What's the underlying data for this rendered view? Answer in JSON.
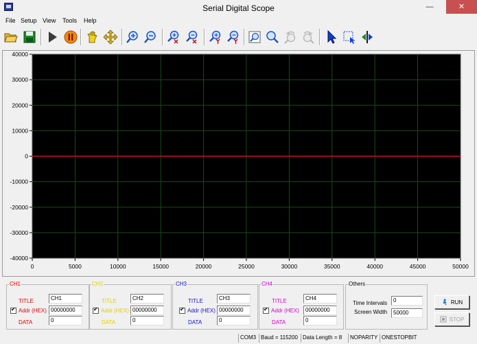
{
  "window": {
    "title": "Serial Digital Scope",
    "minimize_glyph": "—",
    "close_glyph": "✕"
  },
  "menu": [
    "File",
    "Setup",
    "View",
    "Tools",
    "Help"
  ],
  "toolbar": [
    {
      "name": "open-folder-icon",
      "enabled": true
    },
    {
      "name": "save-disk-icon",
      "enabled": true
    },
    {
      "name": "play-icon",
      "enabled": true
    },
    {
      "name": "pause-icon",
      "enabled": true
    },
    {
      "name": "hand-pan-icon",
      "enabled": true
    },
    {
      "name": "move-arrows-icon",
      "enabled": true
    },
    {
      "name": "zoom-in-icon",
      "enabled": true
    },
    {
      "name": "zoom-out-icon",
      "enabled": true
    },
    {
      "name": "zoom-in-x-icon",
      "enabled": true
    },
    {
      "name": "zoom-out-x-icon",
      "enabled": true
    },
    {
      "name": "zoom-in-y-icon",
      "enabled": true
    },
    {
      "name": "zoom-out-y-icon",
      "enabled": true
    },
    {
      "name": "zoom-fit-icon",
      "enabled": true
    },
    {
      "name": "zoom-window-icon",
      "enabled": true
    },
    {
      "name": "undo-zoom-icon",
      "enabled": false
    },
    {
      "name": "redo-zoom-icon",
      "enabled": false
    },
    {
      "name": "select-pointer-icon",
      "enabled": true
    },
    {
      "name": "select-region-icon",
      "enabled": true
    },
    {
      "name": "cursor-marker-icon",
      "enabled": true
    }
  ],
  "chart_data": {
    "type": "line",
    "background": "#000000",
    "grid": true,
    "grid_color": "#1a4a1a",
    "xlim": [
      0,
      50000
    ],
    "ylim": [
      -40000,
      40000
    ],
    "x_ticks": [
      "0",
      "5000",
      "10000",
      "15000",
      "20000",
      "25000",
      "30000",
      "35000",
      "40000",
      "45000",
      "50000"
    ],
    "y_ticks": [
      "40000",
      "30000",
      "20000",
      "10000",
      "0",
      "-10000",
      "-20000",
      "-30000",
      "-40000"
    ],
    "series": [
      {
        "color": "#d01010",
        "x": [
          0,
          50000
        ],
        "y": [
          0,
          0
        ]
      }
    ]
  },
  "channels": [
    {
      "group": "CH1",
      "color": "#e00000",
      "title_label": "TITLE",
      "title_value": "CH1",
      "addr_label": "Addr (HEX)",
      "addr_value": "00000000",
      "data_label": "DATA",
      "data_value": "0",
      "checked": true
    },
    {
      "group": "CH2",
      "color": "#e0d000",
      "title_label": "TITLE",
      "title_value": "CH2",
      "addr_label": "Addr (HEX)",
      "addr_value": "00000000",
      "data_label": "DATA",
      "data_value": "0",
      "checked": true
    },
    {
      "group": "CH3",
      "color": "#1010d0",
      "title_label": "TITLE",
      "title_value": "CH3",
      "addr_label": "Addr (HEX)",
      "addr_value": "00000000",
      "data_label": "DATA",
      "data_value": "0",
      "checked": true
    },
    {
      "group": "CH4",
      "color": "#d000d0",
      "title_label": "TITLE",
      "title_value": "CH4",
      "addr_label": "Addr (HEX)",
      "addr_value": "00000000",
      "data_label": "DATA",
      "data_value": "0",
      "checked": true
    }
  ],
  "others": {
    "group": "Others",
    "time_intervals_label": "Time Intervals",
    "time_intervals_value": "0",
    "screen_width_label": "Screen Width",
    "screen_width_value": "50000"
  },
  "buttons": {
    "run_label": "RUN",
    "stop_label": "STOP"
  },
  "status": {
    "port": "COM3",
    "baud": "Baud = 115200",
    "data_length": "Data Length = 8",
    "parity": "NOPARITY",
    "stop_bits": "ONESTOPBIT"
  }
}
